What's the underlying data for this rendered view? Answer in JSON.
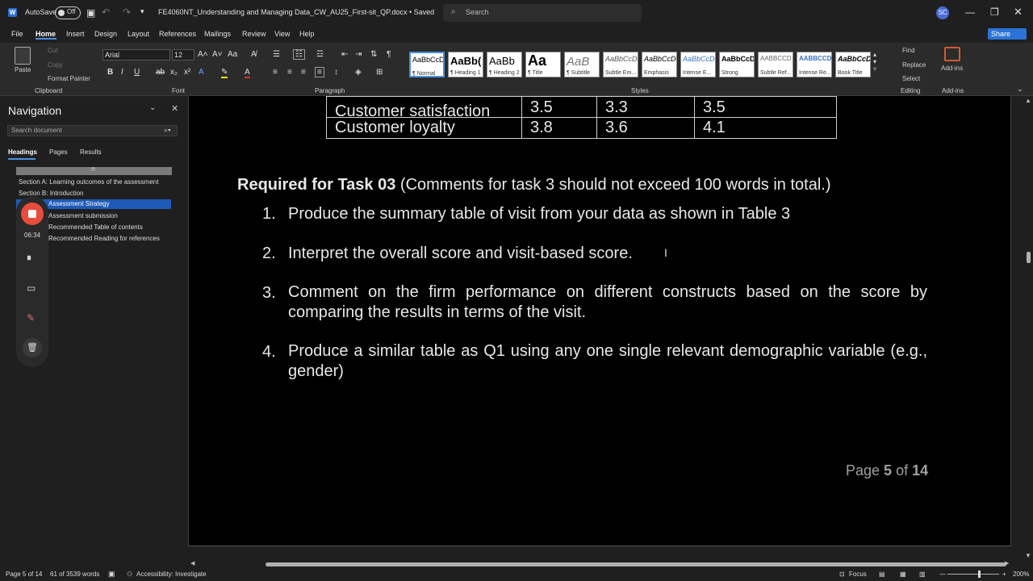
{
  "titlebar": {
    "autosave_label": "AutoSave",
    "autosave_state": "Off",
    "doc_title": "FE4060NT_Understanding and Managing Data_CW_AU25_First-sit_QP.docx • Saved",
    "search_placeholder": "Search",
    "avatar_initials": "SC"
  },
  "menu": {
    "items": [
      "File",
      "Home",
      "Insert",
      "Design",
      "Layout",
      "References",
      "Mailings",
      "Review",
      "View",
      "Help"
    ],
    "active": "Home",
    "share_label": "Share"
  },
  "ribbon": {
    "clipboard": {
      "paste": "Paste",
      "cut": "Cut",
      "copy": "Copy",
      "format_painter": "Format Painter",
      "group": "Clipboard"
    },
    "font": {
      "family": "Arial",
      "size": "12",
      "group": "Font"
    },
    "paragraph": {
      "group": "Paragraph"
    },
    "styles": {
      "group": "Styles",
      "tiles": [
        {
          "sample": "AaBbCcDc",
          "name": "¶ Normal"
        },
        {
          "sample": "AaBb(",
          "name": "¶ Heading 1"
        },
        {
          "sample": "AaBb",
          "name": "¶ Heading 2"
        },
        {
          "sample": "Aa",
          "name": "¶ Title"
        },
        {
          "sample": "AaB",
          "name": "¶ Subtitle"
        },
        {
          "sample": "AaBbCcDc",
          "name": "Subtle Em..."
        },
        {
          "sample": "AaBbCcDc",
          "name": "Emphasis"
        },
        {
          "sample": "AaBbCcDc",
          "name": "Intense E..."
        },
        {
          "sample": "AaBbCcDd",
          "name": "Strong"
        },
        {
          "sample": "AABBCCD",
          "name": "Subtle Ref..."
        },
        {
          "sample": "AABBCCD",
          "name": "Intense Re..."
        },
        {
          "sample": "AaBbCcDc",
          "name": "Book Title"
        }
      ]
    },
    "editing": {
      "find": "Find",
      "replace": "Replace",
      "select": "Select",
      "group": "Editing"
    },
    "addins": {
      "label": "Add-ins",
      "group": "Add-ins"
    }
  },
  "navigation": {
    "title": "Navigation",
    "search_placeholder": "Search document",
    "tabs": [
      "Headings",
      "Pages",
      "Results"
    ],
    "items": [
      {
        "label": "Section A: Learning outcomes of the assessment",
        "selected": false
      },
      {
        "label": "Section B: Introduction",
        "selected": false
      },
      {
        "label": "Assessment Strategy",
        "selected": true
      },
      {
        "label": "Assessment submission",
        "selected": false
      },
      {
        "label": "Recommended Table of contents",
        "selected": false
      },
      {
        "label": "Recommended Reading for references",
        "selected": false
      }
    ]
  },
  "recorder": {
    "time": "06:34"
  },
  "document": {
    "table_rows": [
      {
        "label": "Customer satisfaction",
        "v1": "3.5",
        "v2": "3.3",
        "v3": "3.5"
      },
      {
        "label": "Customer loyalty",
        "v1": "3.8",
        "v2": "3.6",
        "v3": "4.1"
      }
    ],
    "task_heading_bold": "Required for Task 03",
    "task_heading_rest": " (Comments for task 3 should not exceed 100 words in total.)",
    "items": [
      {
        "num": "1.",
        "text": "Produce the summary table of visit from your data as shown in Table 3"
      },
      {
        "num": "2.",
        "text": "Interpret the overall score and visit-based score."
      },
      {
        "num": "3.",
        "text": "Comment on the firm performance on different constructs based on the score by comparing the results in terms of the visit."
      },
      {
        "num": "4.",
        "text": "Produce a similar table as Q1 using any one single relevant demographic variable (e.g., gender)"
      }
    ],
    "page_prefix": "Page ",
    "page_current": "5",
    "page_of": " of ",
    "page_total": "14"
  },
  "status": {
    "page": "Page 5 of 14",
    "words": "61 of 3539 words",
    "accessibility": "Accessibility: Investigate",
    "focus": "Focus",
    "zoom": "200%"
  }
}
